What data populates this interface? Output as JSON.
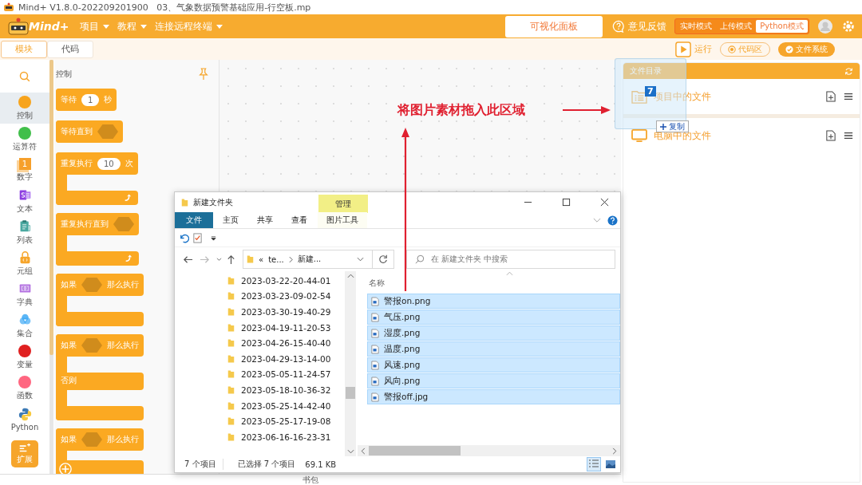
{
  "title_bar": {
    "title": "Mind+ V1.8.0-202209201900   03、气象数据预警基础应用-行空板.mp"
  },
  "menu_bar": {
    "logo": "Mind+",
    "menus": [
      {
        "label": "项目"
      },
      {
        "label": "教程"
      },
      {
        "label": "连接远程终端"
      }
    ],
    "panel_button": "可视化面板",
    "feedback": "意见反馈",
    "modes": [
      {
        "label": "实时模式",
        "selected": false
      },
      {
        "label": "上传模式",
        "selected": false
      },
      {
        "label": "Python模式",
        "selected": true
      }
    ]
  },
  "toolbar": {
    "tabs": [
      {
        "label": "模块",
        "selected": true
      },
      {
        "label": "代码",
        "selected": false
      }
    ],
    "run": "运行",
    "code_area": "代码区",
    "file_system": "文件系统"
  },
  "categories": [
    {
      "label": "控制",
      "kind": "dot",
      "color": "#f7a41d",
      "selected": true
    },
    {
      "label": "运算符",
      "kind": "dot",
      "color": "#40bf4a",
      "selected": false
    },
    {
      "label": "数字",
      "kind": "number",
      "badge": "1",
      "selected": false
    },
    {
      "label": "文本",
      "kind": "text",
      "selected": false
    },
    {
      "label": "列表",
      "kind": "list",
      "selected": false
    },
    {
      "label": "元组",
      "kind": "tuple",
      "selected": false
    },
    {
      "label": "字典",
      "kind": "dict",
      "selected": false
    },
    {
      "label": "集合",
      "kind": "set",
      "selected": false
    },
    {
      "label": "变量",
      "kind": "dot",
      "color": "#e02020",
      "selected": false
    },
    {
      "label": "函数",
      "kind": "dot",
      "color": "#ff6680",
      "selected": false
    },
    {
      "label": "Python",
      "kind": "python",
      "selected": false
    }
  ],
  "extend_button": "扩展",
  "palette": {
    "title": "控制",
    "blocks": [
      {
        "kind": "simple",
        "parts": [
          {
            "kind": "text",
            "text": "等待"
          },
          {
            "kind": "number",
            "text": "1"
          },
          {
            "kind": "text",
            "text": "秒"
          }
        ]
      },
      {
        "kind": "simple",
        "parts": [
          {
            "kind": "text",
            "text": "等待直到"
          },
          {
            "kind": "slot"
          }
        ]
      },
      {
        "kind": "loop",
        "parts": [
          {
            "kind": "text",
            "text": "重复执行"
          },
          {
            "kind": "number",
            "text": "10"
          },
          {
            "kind": "text",
            "text": "次"
          }
        ]
      },
      {
        "kind": "loop",
        "parts": [
          {
            "kind": "text",
            "text": "重复执行直到"
          },
          {
            "kind": "slot"
          }
        ]
      },
      {
        "kind": "if",
        "parts": [
          {
            "kind": "text",
            "text": "如果"
          },
          {
            "kind": "slot"
          },
          {
            "kind": "text",
            "text": "那么执行"
          }
        ]
      },
      {
        "kind": "ifelse",
        "parts": [
          {
            "kind": "text",
            "text": "如果"
          },
          {
            "kind": "slot"
          },
          {
            "kind": "text",
            "text": "那么执行"
          }
        ],
        "else": "否则"
      },
      {
        "kind": "if_plus",
        "parts": [
          {
            "kind": "text",
            "text": "如果"
          },
          {
            "kind": "slot"
          },
          {
            "kind": "text",
            "text": "那么执行"
          }
        ]
      }
    ]
  },
  "annotation": {
    "text": "将图片素材拖入此区域"
  },
  "explorer": {
    "title": "新建文件夹",
    "context_tab": "管理",
    "tabs": [
      {
        "label": "文件",
        "selected": true
      },
      {
        "label": "主页",
        "selected": false
      },
      {
        "label": "共享",
        "selected": false
      },
      {
        "label": "查看",
        "selected": false
      },
      {
        "label": "图片工具",
        "selected": false
      }
    ],
    "path_prefix": "«",
    "path": [
      "te...",
      "新建..."
    ],
    "search_placeholder": "在 新建文件夹 中搜索",
    "column": "名称",
    "folders": [
      "2023-03-22-20-44-01",
      "2023-03-23-09-02-54",
      "2023-03-30-19-40-29",
      "2023-04-19-11-20-53",
      "2023-04-26-15-40-40",
      "2023-04-29-13-14-00",
      "2023-05-05-11-24-57",
      "2023-05-18-10-36-32",
      "2023-05-25-14-42-40",
      "2023-05-25-17-19-08",
      "2023-06-16-16-23-31"
    ],
    "files": [
      {
        "name": "警报on.png",
        "selected": true
      },
      {
        "name": "气压.png",
        "selected": true
      },
      {
        "name": "湿度.png",
        "selected": true
      },
      {
        "name": "温度.png",
        "selected": true
      },
      {
        "name": "风速.png",
        "selected": true
      },
      {
        "name": "风向.png",
        "selected": true
      },
      {
        "name": "警报off.jpg",
        "selected": true
      }
    ],
    "item_count": "7 个项目",
    "selection": "已选择 7 个项目",
    "size": "69.1 KB"
  },
  "file_panel": {
    "title": "文件目录",
    "items": [
      {
        "label": "项目中的文件",
        "kind": "project"
      },
      {
        "label": "电脑中的文件",
        "kind": "computer"
      }
    ]
  },
  "drag": {
    "count": "7",
    "action": "复制"
  },
  "bottom_bar": {
    "label": "书包"
  }
}
